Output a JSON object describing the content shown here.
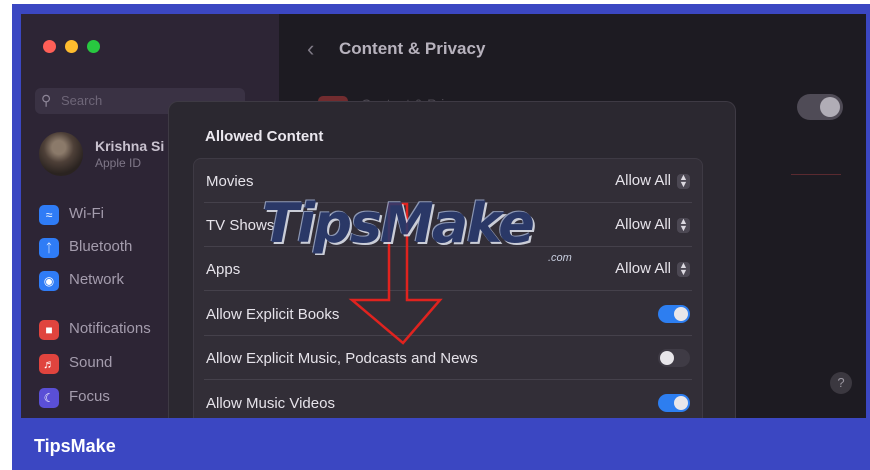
{
  "window": {
    "traffic_colors": [
      "#ff5f57",
      "#febc2e",
      "#28c840"
    ]
  },
  "sidebar": {
    "search_placeholder": "Search",
    "profile": {
      "name": "Krishna Si",
      "subtitle": "Apple ID"
    },
    "items": [
      {
        "label": "Wi-Fi",
        "icon": "wifi-icon",
        "color": "#2f7cf6"
      },
      {
        "label": "Bluetooth",
        "icon": "bluetooth-icon",
        "color": "#2f7cf6"
      },
      {
        "label": "Network",
        "icon": "globe-icon",
        "color": "#2f7cf6"
      },
      {
        "label": "Notifications",
        "icon": "bell-icon",
        "color": "#e0443e"
      },
      {
        "label": "Sound",
        "icon": "speaker-icon",
        "color": "#e0443e"
      },
      {
        "label": "Focus",
        "icon": "moon-icon",
        "color": "#5a4fd6"
      }
    ]
  },
  "header": {
    "title": "Content & Privacy",
    "row_label": "Content & Privacy"
  },
  "sheet": {
    "title": "Allowed Content",
    "rows": [
      {
        "label": "Movies",
        "kind": "select",
        "value": "Allow All"
      },
      {
        "label": "TV Shows",
        "kind": "select",
        "value": "Allow All"
      },
      {
        "label": "Apps",
        "kind": "select",
        "value": "Allow All"
      },
      {
        "label": "Allow Explicit Books",
        "kind": "toggle",
        "on": true
      },
      {
        "label": "Allow Explicit Music, Podcasts and News",
        "kind": "toggle",
        "on": false
      },
      {
        "label": "Allow Music Videos",
        "kind": "toggle",
        "on": true
      }
    ]
  },
  "help_label": "?",
  "watermark": {
    "text": "TipsMake",
    "suffix": ".com"
  },
  "annotation": {
    "arrow_color": "#e0231f"
  },
  "footer": {
    "brand": "TipsMake",
    "color": "#3b47c2"
  }
}
